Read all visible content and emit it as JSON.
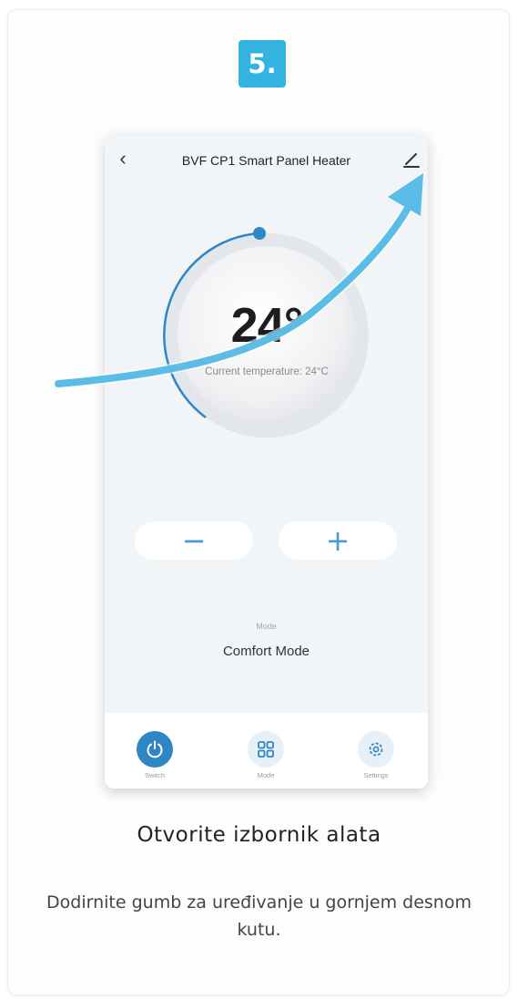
{
  "step": {
    "number": "5."
  },
  "app": {
    "title": "BVF CP1 Smart Panel Heater",
    "back_icon": "chevron-left-icon",
    "edit_icon": "pencil-icon"
  },
  "thermostat": {
    "setpoint": "24°",
    "current_label": "Current temperature: 24°C"
  },
  "controls": {
    "minus": "−",
    "plus": "+"
  },
  "mode": {
    "caption": "Mode",
    "value": "Comfort Mode"
  },
  "tabbar": {
    "items": [
      {
        "label": "Switch",
        "icon": "power-icon"
      },
      {
        "label": "Mode",
        "icon": "grid-icon"
      },
      {
        "label": "Settings",
        "icon": "gear-icon"
      }
    ]
  },
  "instruction": {
    "title": "Otvorite izbornik alata",
    "description": "Dodirnite gumb za uređivanje u gornjem desnom kutu."
  },
  "colors": {
    "accent": "#33b3e0",
    "app_blue": "#2f86c4",
    "arrow": "#5bbde6"
  }
}
